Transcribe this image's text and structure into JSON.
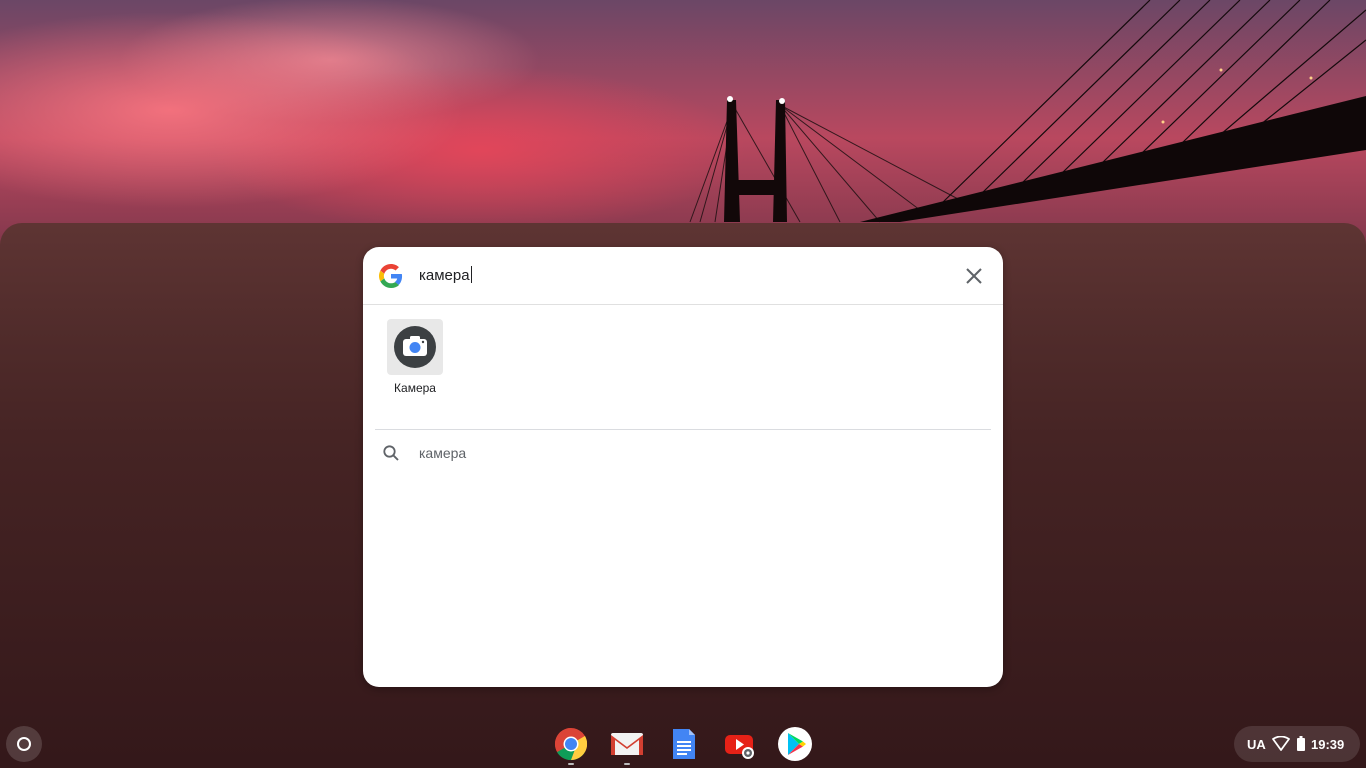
{
  "search": {
    "query": "камера",
    "close_icon": "close-icon",
    "logo": "google-g-logo"
  },
  "apps": [
    {
      "label": "Камера",
      "icon": "camera-icon"
    }
  ],
  "results": [
    {
      "text": "камера",
      "icon": "search-icon"
    }
  ],
  "shelf": {
    "launcher_icon": "launcher-circle-icon",
    "apps": [
      {
        "name": "chrome",
        "icon": "chrome-icon",
        "running": true
      },
      {
        "name": "gmail",
        "icon": "gmail-icon",
        "running": true
      },
      {
        "name": "docs",
        "icon": "docs-icon",
        "running": false
      },
      {
        "name": "youtube",
        "icon": "youtube-icon",
        "running": false
      },
      {
        "name": "play-store",
        "icon": "play-store-icon",
        "running": false
      }
    ]
  },
  "tray": {
    "ime": "UA",
    "wifi_icon": "wifi-icon",
    "battery_icon": "battery-icon",
    "time": "19:39"
  },
  "colors": {
    "google_blue": "#4285F4",
    "google_red": "#EA4335",
    "google_yellow": "#FBBC05",
    "google_green": "#34A853"
  }
}
